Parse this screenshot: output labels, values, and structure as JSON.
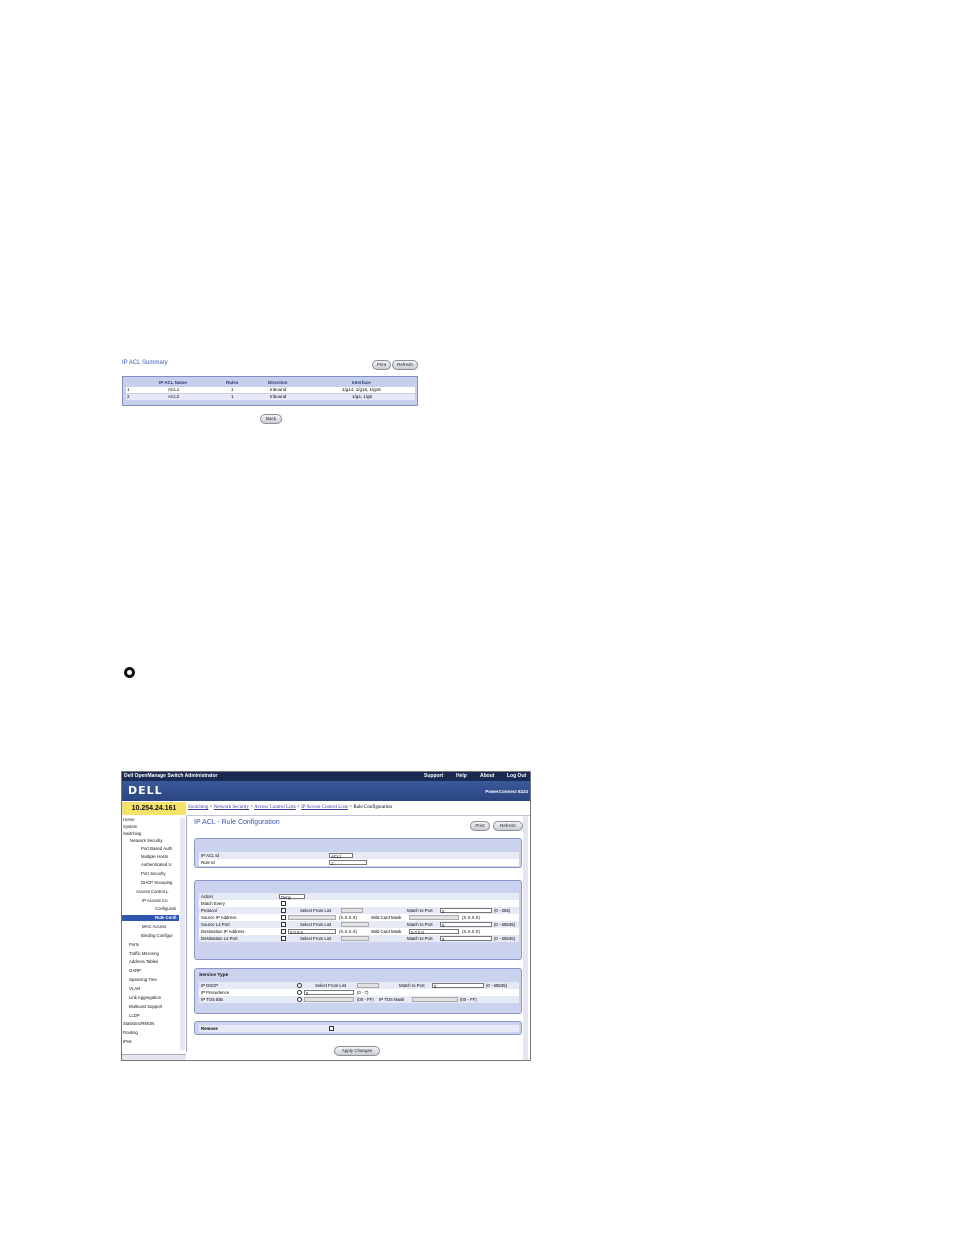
{
  "summary": {
    "title": "IP ACL Summary",
    "buttons": {
      "print": "Print",
      "refresh": "Refresh",
      "back": "Back"
    },
    "columns": [
      "IP ACL Name",
      "Rules",
      "Direction",
      "Interface"
    ],
    "rows": [
      {
        "n": "1",
        "name": "ACL1",
        "rules": "1",
        "dir": "Inbound",
        "iface": "1/g14, 1/g15, 1/g16"
      },
      {
        "n": "2",
        "name": "ACL2",
        "rules": "1",
        "dir": "Inbound",
        "iface": "1/g4, 1/g5"
      }
    ]
  },
  "app": {
    "title": "Dell OpenManage Switch Administrator",
    "menu": [
      "Support",
      "Help",
      "About",
      "Log Out"
    ],
    "logo": "DELL",
    "model": "PowerConnect 6224",
    "ip": "10.254.24.161",
    "breadcrumb": [
      "Switching",
      "Network Security",
      "Access Control Lists",
      "IP Access Control Lists",
      "Rule Configuration"
    ],
    "tree": [
      "Home",
      "System",
      "Switching",
      "Network Security",
      "Port Based Auth",
      "Multiple Hosts",
      "Authenticated U",
      "Port Security",
      "DHCP Snooping",
      "Access Control L",
      "IP Access Co",
      "Configurati",
      "Rule Confi",
      "MAC Access",
      "Binding Configur",
      "Ports",
      "Traffic Mirroring",
      "Address Tables",
      "GARP",
      "Spanning Tree",
      "VLAN",
      "Link Aggregation",
      "Multicast Support",
      "LLDP",
      "Statistics/RMON",
      "Routing",
      "IPv6"
    ],
    "page_title": "IP ACL - Rule Configuration",
    "buttons": {
      "print": "Print",
      "refresh": "Refresh",
      "apply": "Apply Changes"
    },
    "top": {
      "acl_label": "IP ACL Id",
      "acl_value": "ACL1",
      "rule_label": "Rule Id",
      "rule_value": "1"
    },
    "rule": {
      "action_label": "Action",
      "action_value": "Deny",
      "match_every": "Match Every",
      "protocol": "Protocol",
      "select_from_list": "Select From List",
      "match_to_port": "Match to Port",
      "protocol_port": "0",
      "protocol_range": "(0 - 255)",
      "src_ip": "Source IP Address",
      "ip_hint": "(X.X.X.X)",
      "wildcard": "Wild Card Mask",
      "src_l4": "Source L4 Port",
      "port_zero": "0",
      "port_range": "(0 - 65535)",
      "dst_ip": "Destination IP Address",
      "dst_ip_value": "0.0.0.0",
      "dst_wildcard_value": "0.0.0.0",
      "dst_l4": "Destination L4 Port"
    },
    "service": {
      "header": "Service Type",
      "dscp": "IP DSCP",
      "dscp_port": "0",
      "dscp_range": "(0 - 65535)",
      "precedence": "IP Precedence",
      "prec_value": "0",
      "prec_range": "(0 - 7)",
      "tos": "IP TOS Bits",
      "tos_range": "(00 - FF)",
      "tos_mask": "IP TOS Mask",
      "tos_mask_range": "(00 - FF)"
    },
    "remove": "Remove"
  }
}
